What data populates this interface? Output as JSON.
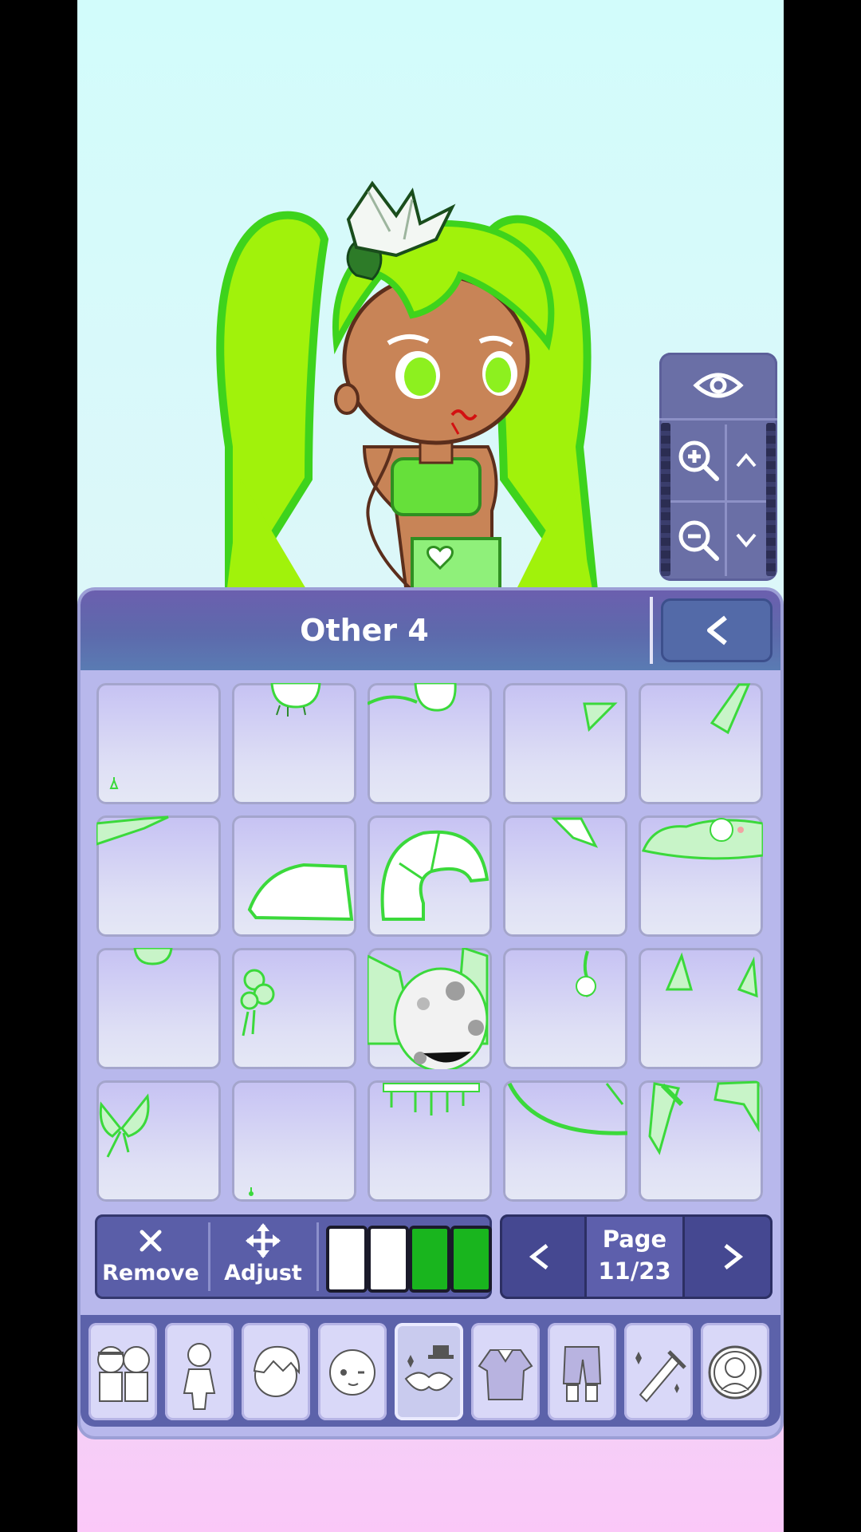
{
  "panel": {
    "title": "Other 4",
    "back_icon": "chevron-left-icon"
  },
  "camera": {
    "icons": [
      "eye-icon",
      "zoom-in-icon",
      "chevron-up-icon",
      "zoom-out-icon",
      "chevron-down-icon"
    ]
  },
  "tools": {
    "remove_label": "Remove",
    "adjust_label": "Adjust",
    "swatch_colors": [
      "#ffffff",
      "#ffffff",
      "#19b51e",
      "#19b51e"
    ]
  },
  "pagination": {
    "label": "Page",
    "value": "11/23"
  },
  "categories": [
    "presets-tab",
    "body-tab",
    "hair-tab",
    "face-tab",
    "accessories-tab",
    "tops-tab",
    "bottoms-tab",
    "props-tab",
    "profile-tab"
  ],
  "active_category": "accessories-tab",
  "colors": {
    "accent": "#5d6aac",
    "item_green": "#3bd93b",
    "hair_green": "#9cf30b"
  }
}
